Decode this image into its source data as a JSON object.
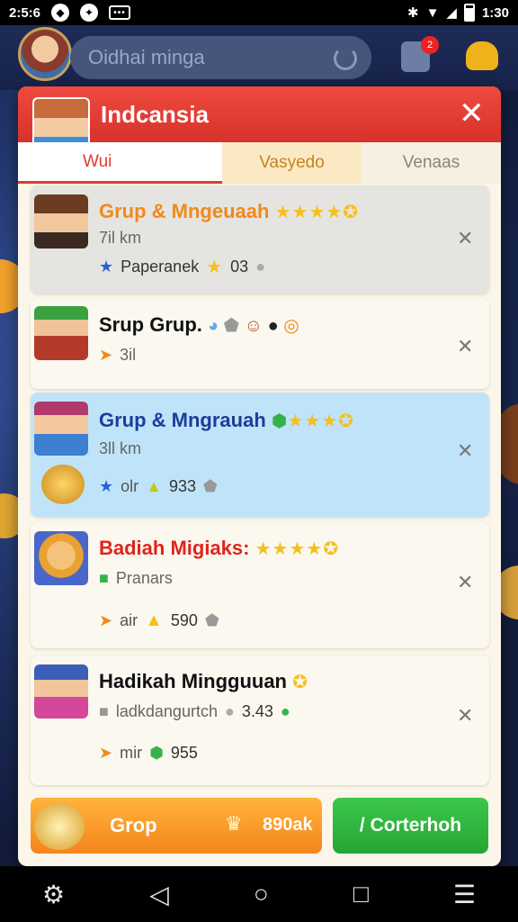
{
  "status_bar": {
    "time_left": "2:5:6",
    "time_right": "1:30"
  },
  "top_bar": {
    "search_placeholder": "Oidhai minga",
    "notification_count": "2"
  },
  "modal": {
    "title": "Indcansia",
    "tabs": [
      {
        "label": "Wui"
      },
      {
        "label": "Vasyedo"
      },
      {
        "label": "Venaas"
      }
    ],
    "items": [
      {
        "title": "Grup & Mngeuaah",
        "title_color": "#f08a1a",
        "subtitle": "7il km",
        "meta_label": "Paperanek",
        "meta_value": "03"
      },
      {
        "title": "Srup Grup.",
        "title_color": "#111111",
        "subtitle": "3il"
      },
      {
        "title": "Grup & Mngrauah",
        "title_color": "#1a3e9a",
        "subtitle": "3ll km",
        "meta_label": "olr",
        "meta_value": "933"
      },
      {
        "title": "Badiah Migiaks:",
        "title_color": "#e0241c",
        "subtitle": "Pranars",
        "meta_label": "air",
        "meta_value": "590"
      },
      {
        "title": "Hadikah Mingguuan",
        "title_color": "#111111",
        "subtitle": "ladkdangurtch",
        "subtitle_value": "3.43",
        "meta_label": "mir",
        "meta_value": "955"
      }
    ],
    "buttons": {
      "group_label": "Grop",
      "group_price": "890ak",
      "confirm_label": "/ Corterhoh"
    }
  }
}
